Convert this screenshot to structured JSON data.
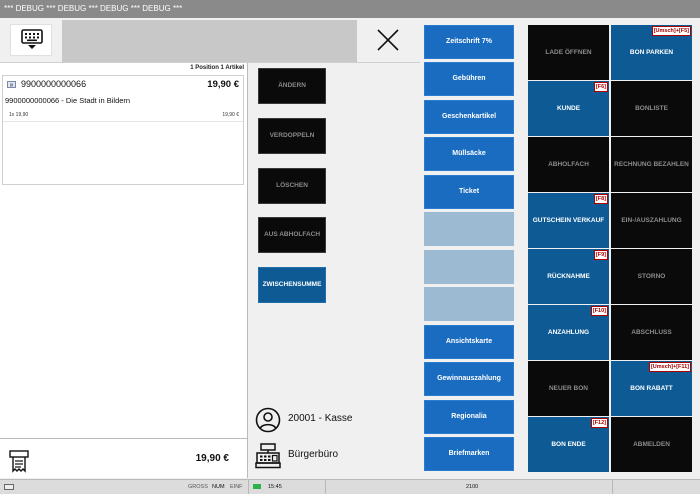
{
  "window": {
    "title": "*** DEBUG *** DEBUG *** DEBUG *** DEBUG ***"
  },
  "header": {
    "keyboard_icon": "keyboard-icon",
    "close_icon": "close-icon",
    "input_value": ""
  },
  "cart": {
    "summary": "1 Position 1 Artikel",
    "items": [
      {
        "code": "9900000000066",
        "price": "19,90 €",
        "description": "9900000000066 - Die Stadt in Bildern",
        "detail_left": "1x 19,90",
        "detail_right": "19,90 €"
      }
    ],
    "total": "19,90 €"
  },
  "actions": {
    "aendern": "ÄNDERN",
    "verdoppeln": "VERDOPPELN",
    "loeschen": "LÖSCHEN",
    "aus_abholfach": "AUS ABHOLFACH",
    "zwischensumme": "ZWISCHENSUMME"
  },
  "session": {
    "user": "20001 -  Kasse",
    "register": "Bürgerbüro"
  },
  "articles": [
    "Zeitschrift 7%",
    "Gebühren",
    "Geschenkartikel",
    "Müllsäcke",
    "Ticket",
    "",
    "",
    "",
    "Ansichtskarte",
    "Gewinnauszahlung",
    "Regionalia",
    "Briefmarken"
  ],
  "functions": [
    {
      "label": "LADE ÖFFNEN",
      "hotkey": "",
      "style": "black"
    },
    {
      "label": "BON PARKEN",
      "hotkey": "[Umsch]+[F5]",
      "style": "blue"
    },
    {
      "label": "KUNDE",
      "hotkey": "[F6]",
      "style": "blue"
    },
    {
      "label": "BONLISTE",
      "hotkey": "",
      "style": "black"
    },
    {
      "label": "ABHOLFACH",
      "hotkey": "",
      "style": "black"
    },
    {
      "label": "RECHNUNG BEZAHLEN",
      "hotkey": "",
      "style": "black"
    },
    {
      "label": "GUTSCHEIN VERKAUF",
      "hotkey": "[F8]",
      "style": "blue"
    },
    {
      "label": "EIN-/AUSZAHLUNG",
      "hotkey": "",
      "style": "black"
    },
    {
      "label": "RÜCKNAHME",
      "hotkey": "[F9]",
      "style": "blue"
    },
    {
      "label": "STORNO",
      "hotkey": "",
      "style": "black"
    },
    {
      "label": "ANZAHLUNG",
      "hotkey": "[F10]",
      "style": "blue"
    },
    {
      "label": "ABSCHLUSS",
      "hotkey": "",
      "style": "black"
    },
    {
      "label": "NEUER BON",
      "hotkey": "",
      "style": "black"
    },
    {
      "label": "BON RABATT",
      "hotkey": "[Umsch]+[F11]",
      "style": "blue"
    },
    {
      "label": "BON ENDE",
      "hotkey": "[F12]",
      "style": "blue"
    },
    {
      "label": "ABMELDEN",
      "hotkey": "",
      "style": "black"
    }
  ],
  "statusbar": {
    "gross": "GROSS",
    "num": "NUM",
    "einf": "EINF",
    "time": "15:45",
    "code": "2100"
  },
  "colors": {
    "accent_blue": "#1a6cc0",
    "function_blue": "#0e5a94",
    "function_black": "#0a0a0a",
    "hotkey_red": "#aa0000"
  }
}
